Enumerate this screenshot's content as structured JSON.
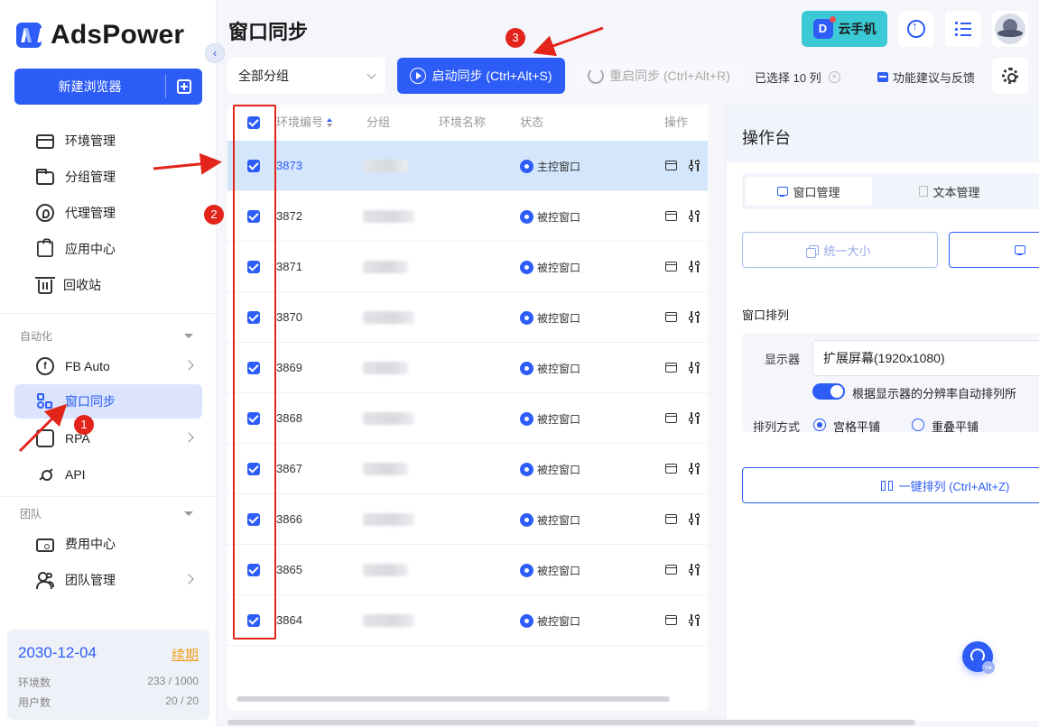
{
  "app": {
    "name": "AdsPower",
    "new_browser": "新建浏览器",
    "collapse_icon": "‹"
  },
  "sidebar": {
    "items": [
      {
        "label": "环境管理",
        "icon": "environment-icon"
      },
      {
        "label": "分组管理",
        "icon": "folder-icon"
      },
      {
        "label": "代理管理",
        "icon": "proxy-icon"
      },
      {
        "label": "应用中心",
        "icon": "app-center-icon"
      },
      {
        "label": "回收站",
        "icon": "trash-icon"
      }
    ],
    "automation_label": "自动化",
    "automation_items": [
      {
        "label": "FB Auto",
        "icon": "fb-auto-icon"
      },
      {
        "label": "窗口同步",
        "icon": "window-sync-icon",
        "active": true
      },
      {
        "label": "RPA",
        "icon": "rpa-icon"
      },
      {
        "label": "API",
        "icon": "api-icon"
      }
    ],
    "team_label": "团队",
    "team_items": [
      {
        "label": "费用中心",
        "icon": "billing-icon"
      },
      {
        "label": "团队管理",
        "icon": "team-icon"
      }
    ],
    "plan": {
      "expiry": "2030-12-04",
      "renew": "续期",
      "env_label": "环境数",
      "env_value": "233 / 1000",
      "user_label": "用户数",
      "user_value": "20 / 20"
    }
  },
  "header": {
    "title": "窗口同步",
    "cloud_phone": "云手机",
    "cloud_phone_glyph": "D"
  },
  "toolbar": {
    "group_select": "全部分组",
    "start_sync": "启动同步 (Ctrl+Alt+S)",
    "restart_sync": "重启同步 (Ctrl+Alt+R)",
    "selected": "已选择 10 列",
    "clear_glyph": "×",
    "feedback": "功能建议与反馈"
  },
  "table": {
    "columns": [
      "环境编号",
      "分组",
      "环境名称",
      "状态",
      "操作"
    ],
    "rows": [
      {
        "id": "3873",
        "status": "主控窗口",
        "selected": true
      },
      {
        "id": "3872",
        "status": "被控窗口",
        "selected": false
      },
      {
        "id": "3871",
        "status": "被控窗口",
        "selected": false
      },
      {
        "id": "3870",
        "status": "被控窗口",
        "selected": false
      },
      {
        "id": "3869",
        "status": "被控窗口",
        "selected": false
      },
      {
        "id": "3868",
        "status": "被控窗口",
        "selected": false
      },
      {
        "id": "3867",
        "status": "被控窗口",
        "selected": false
      },
      {
        "id": "3866",
        "status": "被控窗口",
        "selected": false
      },
      {
        "id": "3865",
        "status": "被控窗口",
        "selected": false
      },
      {
        "id": "3864",
        "status": "被控窗口",
        "selected": false
      }
    ]
  },
  "ops": {
    "title": "操作台",
    "tab_window": "窗口管理",
    "tab_text": "文本管理",
    "uniform_size": "统一大小",
    "arrange_title": "窗口排列",
    "display_label": "显示器",
    "display_value": "扩展屏幕(1920x1080)",
    "auto_arrange": "根据显示器的分辨率自动排列所",
    "arrange_mode_label": "排列方式",
    "mode_grid": "宫格平铺",
    "mode_overlap": "重叠平铺",
    "one_key": "一键排列 (Ctrl+Alt+Z)"
  },
  "annotations": {
    "badge1": "1",
    "badge2": "2",
    "badge3": "3"
  },
  "colors": {
    "primary": "#2d5cf6",
    "annotation": "#e3241b",
    "selected_row": "#d4e6fb"
  }
}
